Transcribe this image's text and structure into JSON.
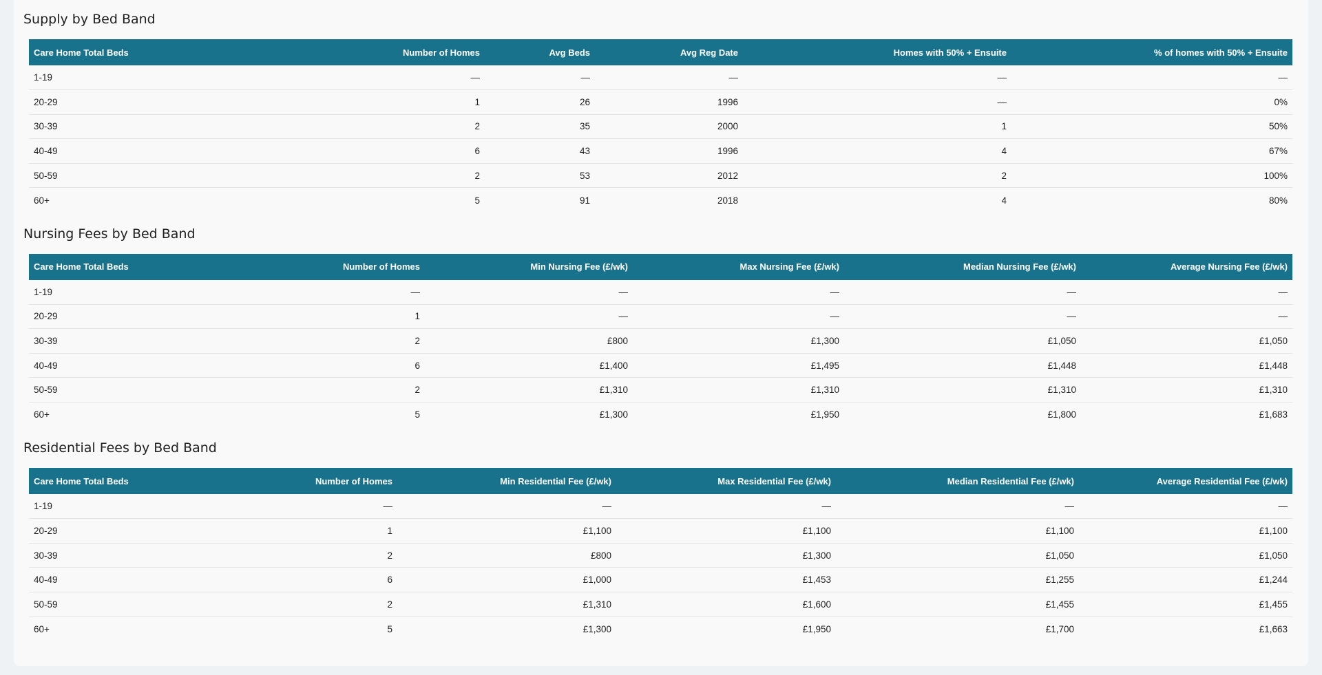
{
  "sections": [
    {
      "title": "Supply by Bed Band",
      "columns": [
        "Care Home Total Beds",
        "Number of Homes",
        "Avg Beds",
        "Avg Reg Date",
        "Homes with 50% + Ensuite",
        "% of homes with 50% + Ensuite"
      ],
      "rows": [
        [
          "1-19",
          "—",
          "—",
          "—",
          "—",
          "—"
        ],
        [
          "20-29",
          "1",
          "26",
          "1996",
          "—",
          "0%"
        ],
        [
          "30-39",
          "2",
          "35",
          "2000",
          "1",
          "50%"
        ],
        [
          "40-49",
          "6",
          "43",
          "1996",
          "4",
          "67%"
        ],
        [
          "50-59",
          "2",
          "53",
          "2012",
          "2",
          "100%"
        ],
        [
          "60+",
          "5",
          "91",
          "2018",
          "4",
          "80%"
        ]
      ]
    },
    {
      "title": "Nursing Fees by Bed Band",
      "columns": [
        "Care Home Total Beds",
        "Number of Homes",
        "Min Nursing Fee (£/wk)",
        "Max Nursing Fee (£/wk)",
        "Median Nursing Fee (£/wk)",
        "Average Nursing Fee (£/wk)"
      ],
      "rows": [
        [
          "1-19",
          "—",
          "—",
          "—",
          "—",
          "—"
        ],
        [
          "20-29",
          "1",
          "—",
          "—",
          "—",
          "—"
        ],
        [
          "30-39",
          "2",
          "£800",
          "£1,300",
          "£1,050",
          "£1,050"
        ],
        [
          "40-49",
          "6",
          "£1,400",
          "£1,495",
          "£1,448",
          "£1,448"
        ],
        [
          "50-59",
          "2",
          "£1,310",
          "£1,310",
          "£1,310",
          "£1,310"
        ],
        [
          "60+",
          "5",
          "£1,300",
          "£1,950",
          "£1,800",
          "£1,683"
        ]
      ]
    },
    {
      "title": "Residential Fees by Bed Band",
      "columns": [
        "Care Home Total Beds",
        "Number of Homes",
        "Min Residential Fee (£/wk)",
        "Max Residential Fee (£/wk)",
        "Median Residential Fee (£/wk)",
        "Average Residential Fee (£/wk)"
      ],
      "rows": [
        [
          "1-19",
          "—",
          "—",
          "—",
          "—",
          "—"
        ],
        [
          "20-29",
          "1",
          "£1,100",
          "£1,100",
          "£1,100",
          "£1,100"
        ],
        [
          "30-39",
          "2",
          "£800",
          "£1,300",
          "£1,050",
          "£1,050"
        ],
        [
          "40-49",
          "6",
          "£1,000",
          "£1,453",
          "£1,255",
          "£1,244"
        ],
        [
          "50-59",
          "2",
          "£1,310",
          "£1,600",
          "£1,455",
          "£1,455"
        ],
        [
          "60+",
          "5",
          "£1,300",
          "£1,950",
          "£1,700",
          "£1,663"
        ]
      ]
    }
  ]
}
